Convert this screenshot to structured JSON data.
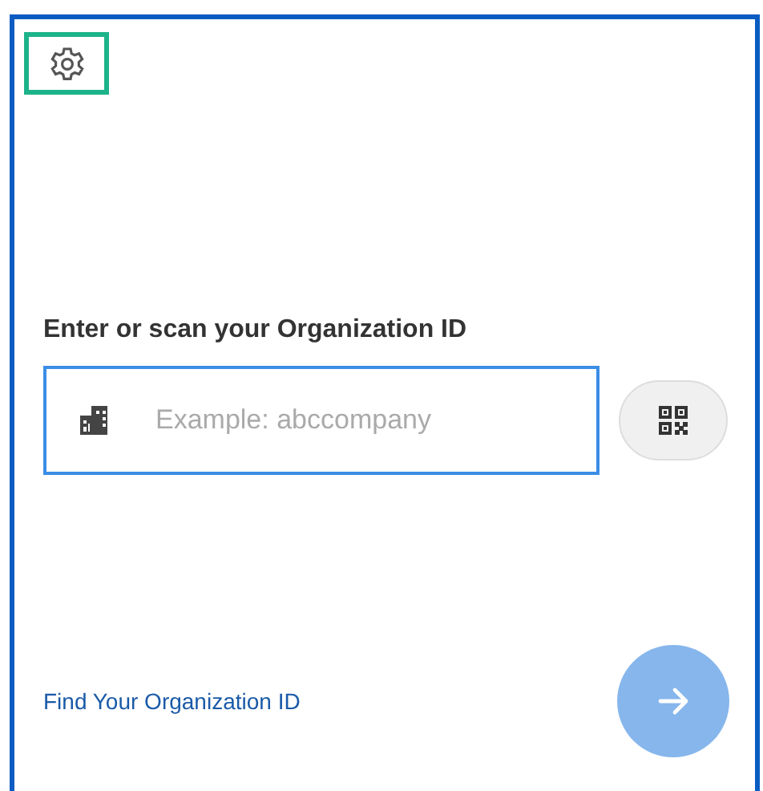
{
  "settings": {
    "highlighted": true
  },
  "org_id": {
    "label": "Enter or scan your Organization ID",
    "placeholder": "Example: abccompany"
  },
  "find_link": "Find Your Organization ID",
  "next_button": {
    "disabled": true
  }
}
